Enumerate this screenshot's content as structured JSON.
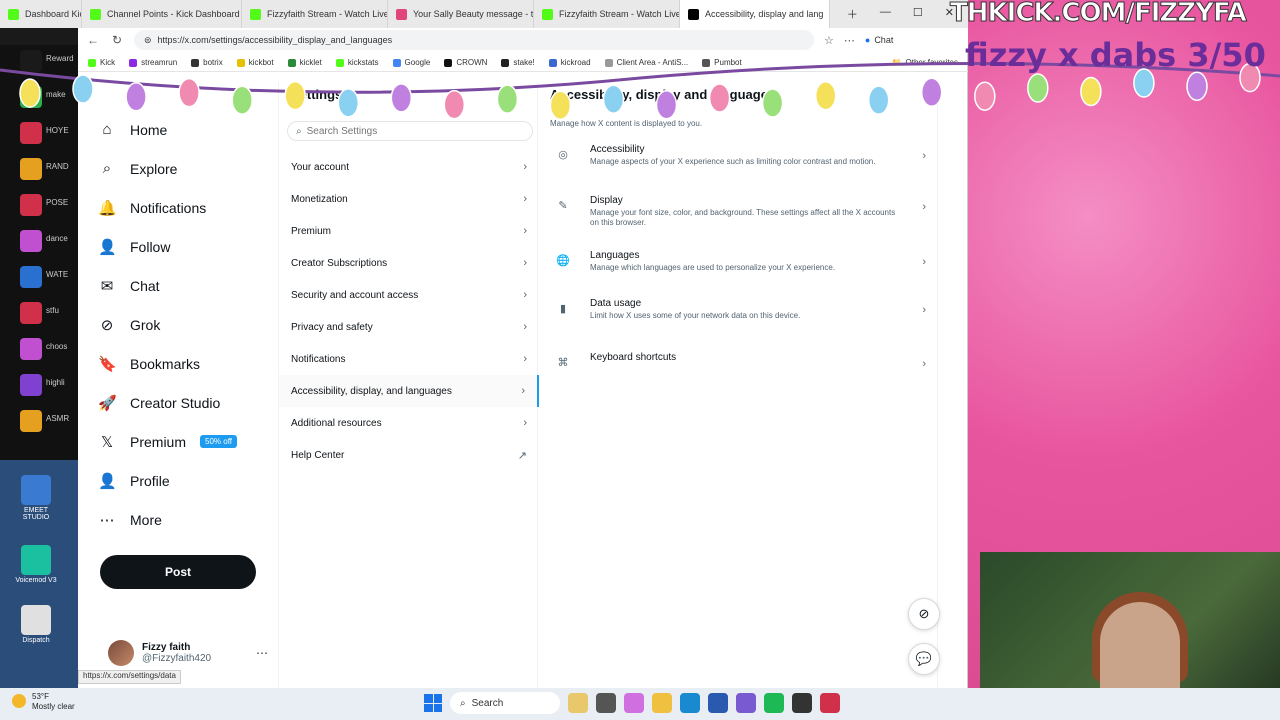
{
  "browser": {
    "tabs": [
      {
        "title": "Dashboard Kick",
        "color": "#53fc18",
        "active": false
      },
      {
        "title": "Channel Points - Kick Dashboard",
        "color": "#53fc18",
        "active": false
      },
      {
        "title": "Fizzyfaith Stream - Watch Live",
        "color": "#53fc18",
        "active": false
      },
      {
        "title": "Your Sally Beauty message - ti",
        "color": "#e0457b",
        "active": false
      },
      {
        "title": "Fizzyfaith Stream - Watch Live",
        "color": "#53fc18",
        "active": false
      },
      {
        "title": "Accessibility, display and lang",
        "color": "#000000",
        "active": true
      }
    ],
    "url": "https://x.com/settings/accessibility_display_and_languages",
    "chat_label": "Chat",
    "bookmarks": [
      {
        "label": "Kick",
        "color": "#53fc18"
      },
      {
        "label": "streamrun",
        "color": "#8a2be2"
      },
      {
        "label": "botrix",
        "color": "#333333"
      },
      {
        "label": "kickbot",
        "color": "#e5c100"
      },
      {
        "label": "kicklet",
        "color": "#2a8a3a"
      },
      {
        "label": "kickstats",
        "color": "#53fc18"
      },
      {
        "label": "Google",
        "color": "#4285f4"
      },
      {
        "label": "CROWN",
        "color": "#111111"
      },
      {
        "label": "stake!",
        "color": "#222222"
      },
      {
        "label": "kickroad",
        "color": "#3a6ad0"
      },
      {
        "label": "Client Area - AntiS...",
        "color": "#999999"
      },
      {
        "label": "Pumbot",
        "color": "#555555"
      }
    ],
    "other_favorites": "Other favorites",
    "status_url": "https://x.com/settings/data"
  },
  "sidebar": {
    "items": [
      {
        "label": "Home",
        "icon": "⌂",
        "name": "home"
      },
      {
        "label": "Explore",
        "icon": "⌕",
        "name": "explore"
      },
      {
        "label": "Notifications",
        "icon": "🔔",
        "name": "notifications"
      },
      {
        "label": "Follow",
        "icon": "👤",
        "name": "follow"
      },
      {
        "label": "Chat",
        "icon": "✉",
        "name": "chat"
      },
      {
        "label": "Grok",
        "icon": "⊘",
        "name": "grok"
      },
      {
        "label": "Bookmarks",
        "icon": "🔖",
        "name": "bookmarks"
      },
      {
        "label": "Creator Studio",
        "icon": "🚀",
        "name": "creator-studio"
      },
      {
        "label": "Premium",
        "icon": "𝕏",
        "name": "premium"
      },
      {
        "label": "Profile",
        "icon": "👤",
        "name": "profile"
      },
      {
        "label": "More",
        "icon": "⋯",
        "name": "more"
      }
    ],
    "premium_badge": "50% off",
    "post_label": "Post",
    "profile": {
      "name": "Fizzy faith",
      "handle": "@Fizzyfaith420"
    }
  },
  "settings": {
    "title": "Settings",
    "search_placeholder": "Search Settings",
    "items": [
      {
        "label": "Your account",
        "arrow": "›"
      },
      {
        "label": "Monetization",
        "arrow": "›"
      },
      {
        "label": "Premium",
        "arrow": "›"
      },
      {
        "label": "Creator Subscriptions",
        "arrow": "›"
      },
      {
        "label": "Security and account access",
        "arrow": "›"
      },
      {
        "label": "Privacy and safety",
        "arrow": "›"
      },
      {
        "label": "Notifications",
        "arrow": "›"
      },
      {
        "label": "Accessibility, display, and languages",
        "arrow": "›",
        "active": true
      },
      {
        "label": "Additional resources",
        "arrow": "›"
      },
      {
        "label": "Help Center",
        "arrow": "↗"
      }
    ]
  },
  "detail": {
    "title": "Accessibility, display and languages",
    "subtitle": "Manage how X content is displayed to you.",
    "items": [
      {
        "label": "Accessibility",
        "desc": "Manage aspects of your X experience such as limiting color contrast and motion.",
        "icon": "◎"
      },
      {
        "label": "Display",
        "desc": "Manage your font size, color, and background. These settings affect all the X accounts on this browser.",
        "icon": "✎"
      },
      {
        "label": "Languages",
        "desc": "Manage which languages are used to personalize your X experience.",
        "icon": "🌐"
      },
      {
        "label": "Data usage",
        "desc": "Limit how X uses some of your network data on this device.",
        "icon": "▮"
      },
      {
        "label": "Keyboard shortcuts",
        "desc": "",
        "icon": "⌘"
      }
    ]
  },
  "overlay": {
    "banner": "THKICK.COM/FIZZYFA",
    "counter": "fizzy x dabs 3/50"
  },
  "left_apps": [
    {
      "label": "Reward red",
      "color": "#1a1a1a"
    },
    {
      "label": "make",
      "color": "#2ab04a"
    },
    {
      "label": "HOYE",
      "color": "#d0304a"
    },
    {
      "label": "RAND",
      "color": "#e5a020"
    },
    {
      "label": "POSE",
      "color": "#d0304a"
    },
    {
      "label": "dance",
      "color": "#c050d0"
    },
    {
      "label": "WATE",
      "color": "#2a70d0"
    },
    {
      "label": "stfu",
      "color": "#d0304a"
    },
    {
      "label": "choos",
      "color": "#c050d0"
    },
    {
      "label": "highli",
      "color": "#8040d0"
    },
    {
      "label": "ASMR",
      "color": "#e5a020"
    }
  ],
  "desktop_icons": [
    {
      "label": "EMEET STUDIO",
      "color": "#3a7ad0"
    },
    {
      "label": "Voicemod V3",
      "color": "#1ac0a0"
    },
    {
      "label": "Dispatch",
      "color": "#e0e0e0"
    }
  ],
  "taskbar": {
    "weather_temp": "53°F",
    "weather_desc": "Mostly clear",
    "search_label": "Search"
  }
}
